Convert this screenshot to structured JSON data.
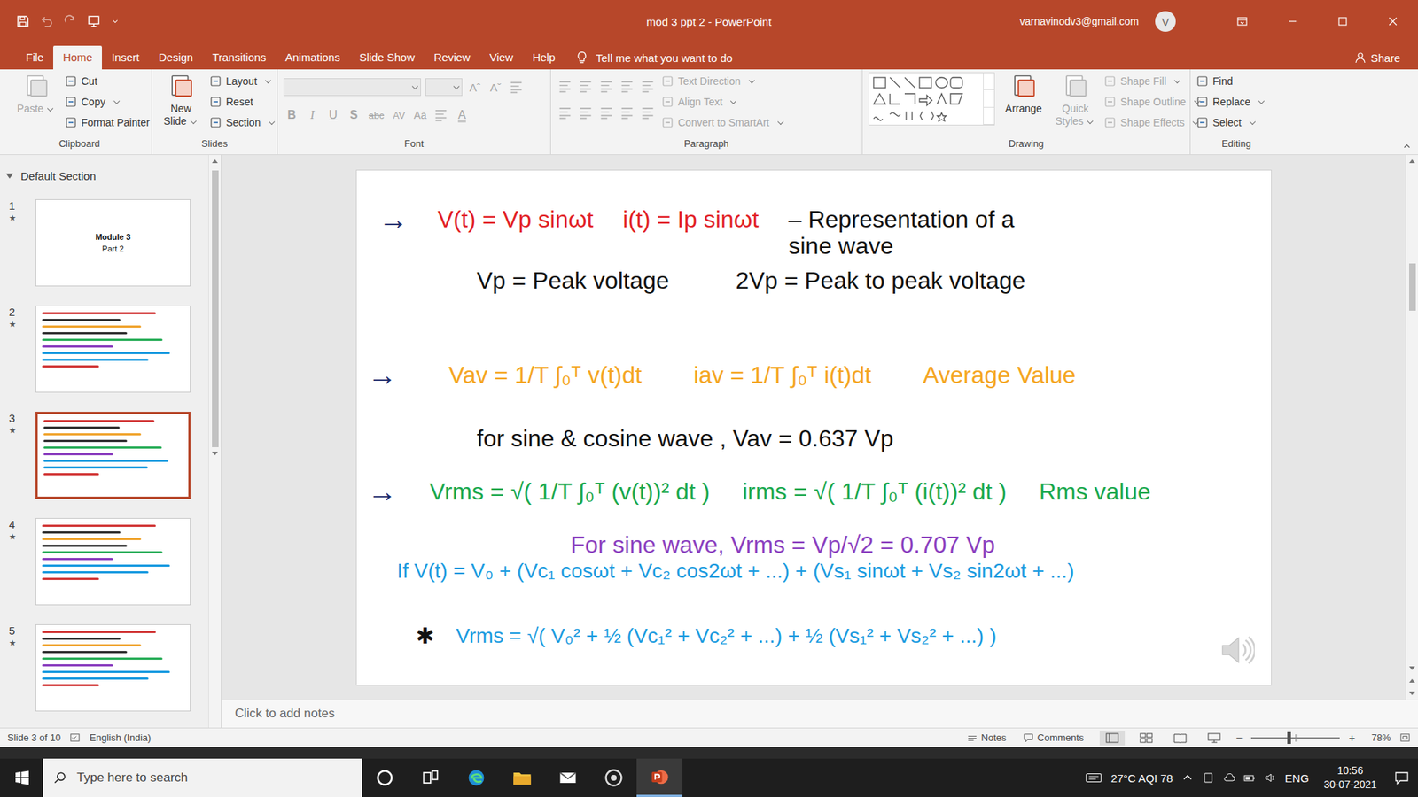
{
  "window": {
    "title": "mod 3 ppt 2 - PowerPoint",
    "account": "varnavinodv3@gmail.com",
    "avatar": "V"
  },
  "menu": {
    "tabs": [
      {
        "label": "File",
        "selected": false
      },
      {
        "label": "Home",
        "selected": true
      },
      {
        "label": "Insert",
        "selected": false
      },
      {
        "label": "Design",
        "selected": false
      },
      {
        "label": "Transitions",
        "selected": false
      },
      {
        "label": "Animations",
        "selected": false
      },
      {
        "label": "Slide Show",
        "selected": false
      },
      {
        "label": "Review",
        "selected": false
      },
      {
        "label": "View",
        "selected": false
      },
      {
        "label": "Help",
        "selected": false
      }
    ],
    "tell_me": "Tell me what you want to do",
    "share": "Share"
  },
  "ribbon": {
    "groups": [
      {
        "label": "Clipboard",
        "columns": [
          [
            [
              {
                "kind": "large",
                "label": "Paste",
                "disabled": true,
                "dropdown": true
              }
            ]
          ],
          [
            [
              {
                "kind": "small",
                "label": "Cut",
                "disabled": false,
                "dropdown": false
              }
            ],
            [
              {
                "kind": "small",
                "label": "Copy",
                "disabled": false,
                "dropdown": true
              }
            ],
            [
              {
                "kind": "small",
                "label": "Format Painter",
                "disabled": false,
                "dropdown": false
              }
            ]
          ]
        ]
      },
      {
        "label": "Slides",
        "columns": [
          [
            [
              {
                "kind": "large",
                "label": "New Slide",
                "disabled": false,
                "dropdown": true
              }
            ]
          ],
          [
            [
              {
                "kind": "small",
                "label": "Layout",
                "disabled": false,
                "dropdown": true
              }
            ],
            [
              {
                "kind": "small",
                "label": "Reset",
                "disabled": false,
                "dropdown": false
              }
            ],
            [
              {
                "kind": "small",
                "label": "Section",
                "disabled": false,
                "dropdown": true
              }
            ]
          ]
        ]
      },
      {
        "label": "Font",
        "columns": [
          [
            [
              {
                "kind": "field",
                "disabled": true
              },
              {
                "kind": "field-sm",
                "disabled": true
              },
              {
                "kind": "glyph",
                "label": "Aˆ",
                "format": "grow",
                "disabled": true
              },
              {
                "kind": "glyph",
                "label": "Aˇ",
                "format": "shrink",
                "disabled": true
              },
              {
                "kind": "icon",
                "disabled": true
              }
            ],
            [
              {
                "kind": "glyph",
                "label": "B",
                "format": "bold",
                "disabled": true
              },
              {
                "kind": "glyph",
                "label": "I",
                "format": "italic",
                "disabled": true
              },
              {
                "kind": "glyph",
                "label": "U",
                "format": "underline",
                "disabled": true
              },
              {
                "kind": "glyph",
                "label": "S",
                "format": "shadow",
                "disabled": true
              },
              {
                "kind": "glyph",
                "label": "abc",
                "format": "strike",
                "disabled": true
              },
              {
                "kind": "glyph",
                "label": "AV",
                "format": "spacing",
                "disabled": true
              },
              {
                "kind": "glyph",
                "label": "Aa",
                "format": "case",
                "disabled": true
              },
              {
                "kind": "icon",
                "disabled": true
              },
              {
                "kind": "glyph",
                "label": "A",
                "format": "color",
                "disabled": true
              }
            ]
          ]
        ]
      },
      {
        "label": "Paragraph",
        "columns": [
          [
            [
              {
                "kind": "icon",
                "disabled": true
              },
              {
                "kind": "icon",
                "disabled": true
              },
              {
                "kind": "icon",
                "disabled": true
              },
              {
                "kind": "icon",
                "disabled": true
              },
              {
                "kind": "icon",
                "disabled": true
              }
            ],
            [
              {
                "kind": "icon",
                "disabled": true
              },
              {
                "kind": "icon",
                "disabled": true
              },
              {
                "kind": "icon",
                "disabled": true
              },
              {
                "kind": "icon",
                "disabled": true
              },
              {
                "kind": "icon",
                "disabled": true
              }
            ]
          ],
          [
            [
              {
                "kind": "small",
                "label": "Text Direction",
                "disabled": true,
                "dropdown": true
              }
            ],
            [
              {
                "kind": "small",
                "label": "Align Text",
                "disabled": true,
                "dropdown": true
              }
            ],
            [
              {
                "kind": "small",
                "label": "Convert to SmartArt",
                "disabled": true,
                "dropdown": true
              }
            ]
          ]
        ]
      },
      {
        "label": "Drawing",
        "columns": [
          [
            [
              {
                "kind": "gallery",
                "disabled": false
              }
            ]
          ],
          [
            [
              {
                "kind": "large",
                "label": "Arrange",
                "disabled": false,
                "dropdown": false
              }
            ]
          ],
          [
            [
              {
                "kind": "large",
                "label": "Quick Styles",
                "disabled": true,
                "dropdown": true
              }
            ]
          ],
          [
            [
              {
                "kind": "small",
                "label": "Shape Fill",
                "disabled": true,
                "dropdown": true
              }
            ],
            [
              {
                "kind": "small",
                "label": "Shape Outline",
                "disabled": true,
                "dropdown": true
              }
            ],
            [
              {
                "kind": "small",
                "label": "Shape Effects",
                "disabled": true,
                "dropdown": true
              }
            ]
          ]
        ]
      },
      {
        "label": "Editing",
        "columns": [
          [
            [
              {
                "kind": "small",
                "label": "Find",
                "disabled": false,
                "dropdown": false
              }
            ],
            [
              {
                "kind": "small",
                "label": "Replace",
                "disabled": false,
                "dropdown": true
              }
            ],
            [
              {
                "kind": "small",
                "label": "Select",
                "disabled": false,
                "dropdown": true
              }
            ]
          ]
        ]
      }
    ]
  },
  "thumbnails": {
    "section": "Default Section",
    "slides": [
      {
        "number": "1",
        "mark": "★",
        "selected": false,
        "kind": "title",
        "lines": [
          "Module 3",
          "Part 2"
        ]
      },
      {
        "number": "2",
        "mark": "★",
        "selected": false,
        "kind": "handwritten",
        "lines": []
      },
      {
        "number": "3",
        "mark": "★",
        "selected": true,
        "kind": "handwritten",
        "lines": []
      },
      {
        "number": "4",
        "mark": "★",
        "selected": false,
        "kind": "handwritten",
        "lines": []
      },
      {
        "number": "5",
        "mark": "★",
        "selected": false,
        "kind": "handwritten",
        "lines": []
      }
    ]
  },
  "slide": {
    "rows": [
      [
        {
          "kind": "arrow",
          "text": "→",
          "color": "#1b2a6b"
        },
        {
          "kind": "ink",
          "text": "V(t) = Vp sinωt",
          "color": "#e21f26"
        },
        {
          "kind": "ink",
          "text": "i(t) = Ip sinωt",
          "color": "#e21f26"
        },
        {
          "kind": "ink",
          "text": "– Representation of a sine wave",
          "color": "#111111"
        }
      ],
      [
        {
          "kind": "ink",
          "text": "Vp = Peak voltage",
          "color": "#111111"
        },
        {
          "kind": "ink",
          "text": "2Vp = Peak to peak voltage",
          "color": "#111111"
        }
      ],
      [
        {
          "kind": "arrow",
          "text": "→",
          "color": "#1b2a6b"
        },
        {
          "kind": "ink",
          "text": "Vav = 1/T ∫₀ᵀ v(t)dt",
          "color": "#f5a623"
        },
        {
          "kind": "ink",
          "text": "iav = 1/T ∫₀ᵀ i(t)dt",
          "color": "#f5a623"
        },
        {
          "kind": "ink",
          "text": "Average Value",
          "color": "#f5a623"
        }
      ],
      [
        {
          "kind": "ink",
          "text": "for sine & cosine wave , Vav = 0.637 Vp",
          "color": "#111111"
        }
      ],
      [
        {
          "kind": "arrow",
          "text": "→",
          "color": "#1b2a6b"
        },
        {
          "kind": "ink",
          "text": "Vrms = √( 1/T ∫₀ᵀ (v(t))² dt )",
          "color": "#19a84c"
        },
        {
          "kind": "ink",
          "text": "irms = √( 1/T ∫₀ᵀ (i(t))² dt )",
          "color": "#19a84c"
        },
        {
          "kind": "ink",
          "text": "Rms value",
          "color": "#19a84c"
        }
      ],
      [
        {
          "kind": "ink",
          "text": "For sine wave, Vrms = Vp/√2 = 0.707 Vp",
          "color": "#8b3fbf"
        }
      ],
      [
        {
          "kind": "ink",
          "text": "If V(t) = V₀ + (Vc₁ cosωt + Vc₂ cos2ωt + ...) + (Vs₁ sinωt + Vs₂ sin2ωt + ...)",
          "color": "#1b9be0"
        }
      ],
      [
        {
          "kind": "star",
          "text": "✱",
          "color": "#111111"
        },
        {
          "kind": "ink",
          "text": "Vrms = √( V₀² + ½ (Vc₁² + Vc₂² + ...) + ½ (Vs₁² + Vs₂² + ...) )",
          "color": "#1b9be0"
        }
      ]
    ]
  },
  "notes": {
    "placeholder": "Click to add notes"
  },
  "status_bar": {
    "slide": "Slide 3 of 10",
    "language": "English (India)",
    "notes": "Notes",
    "comments": "Comments",
    "minus": "−",
    "plus": "+",
    "zoom": "78%",
    "zoom_level": 0.42
  },
  "taskbar": {
    "search": "Type here to search",
    "weather": "27°C AQI 78",
    "language": "ENG",
    "time": "10:56",
    "date": "30-07-2021",
    "powerpoint_active": true
  }
}
